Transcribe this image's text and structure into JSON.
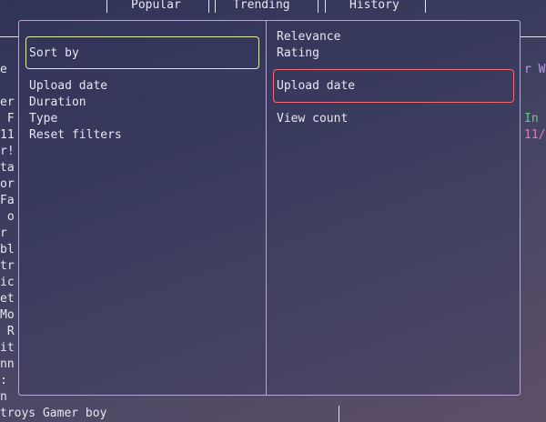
{
  "tabs": [
    {
      "label": "Popular"
    },
    {
      "label": "Trending"
    },
    {
      "label": "History"
    }
  ],
  "dialog": {
    "left_items": [
      "Sort by",
      "Upload date",
      "Duration",
      "Type",
      "Reset filters"
    ],
    "right_items": [
      "Relevance",
      "Rating",
      "Upload date",
      "View count"
    ]
  },
  "background": {
    "left_fragments": [
      "e",
      "er",
      " F",
      "11",
      "r!",
      "ta",
      "or",
      "Fa",
      " o",
      "r",
      "bl",
      "tr",
      "ic",
      "et",
      "Mo",
      " R",
      "it",
      "nn",
      ":",
      "n"
    ],
    "bottom_text": "troys Gamer boy",
    "right_fragments": [
      "r W",
      "In",
      "11/"
    ]
  },
  "colors": {
    "dialog_border": "#b9a6d8",
    "sort_highlight": "#e6eaa8",
    "upload_highlight": "#f06a78",
    "right_purple": "#b99be0",
    "right_green": "#5fd07a",
    "right_pink": "#e07ab8"
  }
}
